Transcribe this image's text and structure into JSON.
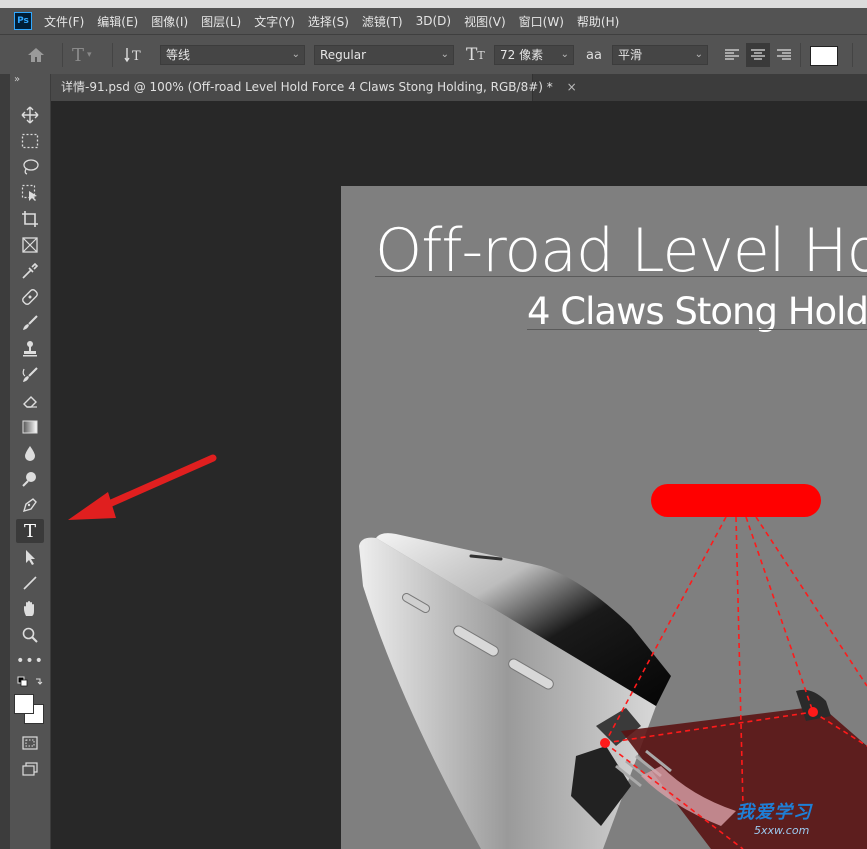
{
  "app": {
    "logo_text": "Ps",
    "menu": [
      "文件(F)",
      "编辑(E)",
      "图像(I)",
      "图层(L)",
      "文字(Y)",
      "选择(S)",
      "滤镜(T)",
      "3D(D)",
      "视图(V)",
      "窗口(W)",
      "帮助(H)"
    ]
  },
  "options": {
    "font_family": "等线",
    "font_style": "Regular",
    "font_size": "72 像素",
    "aa_icon": "aa",
    "anti_alias": "平滑",
    "colors": {
      "swatch": "#ffffff"
    }
  },
  "document_tab": {
    "title": "详情-91.psd @ 100% (Off-road Level Hold Force 4 Claws Stong Holding, RGB/8#) *",
    "close": "×"
  },
  "tools": [
    "move-icon",
    "marquee-icon",
    "lasso-icon",
    "object-select-icon",
    "crop-icon",
    "frame-icon",
    "eyedropper-icon",
    "healing-brush-icon",
    "brush-icon",
    "clone-stamp-icon",
    "history-brush-icon",
    "eraser-icon",
    "gradient-icon",
    "blur-icon",
    "dodge-icon",
    "pen-icon",
    "type-icon",
    "path-select-icon",
    "line-icon",
    "hand-icon",
    "zoom-icon",
    "more-icon"
  ],
  "active_tool": "type-icon",
  "canvas": {
    "headline": "Off-road Level Ho",
    "subheadline": "4 Claws Stong Hold",
    "accent_color": "#ff0000"
  },
  "watermark": {
    "text": "我爱学习",
    "url": "5xxw.com"
  }
}
